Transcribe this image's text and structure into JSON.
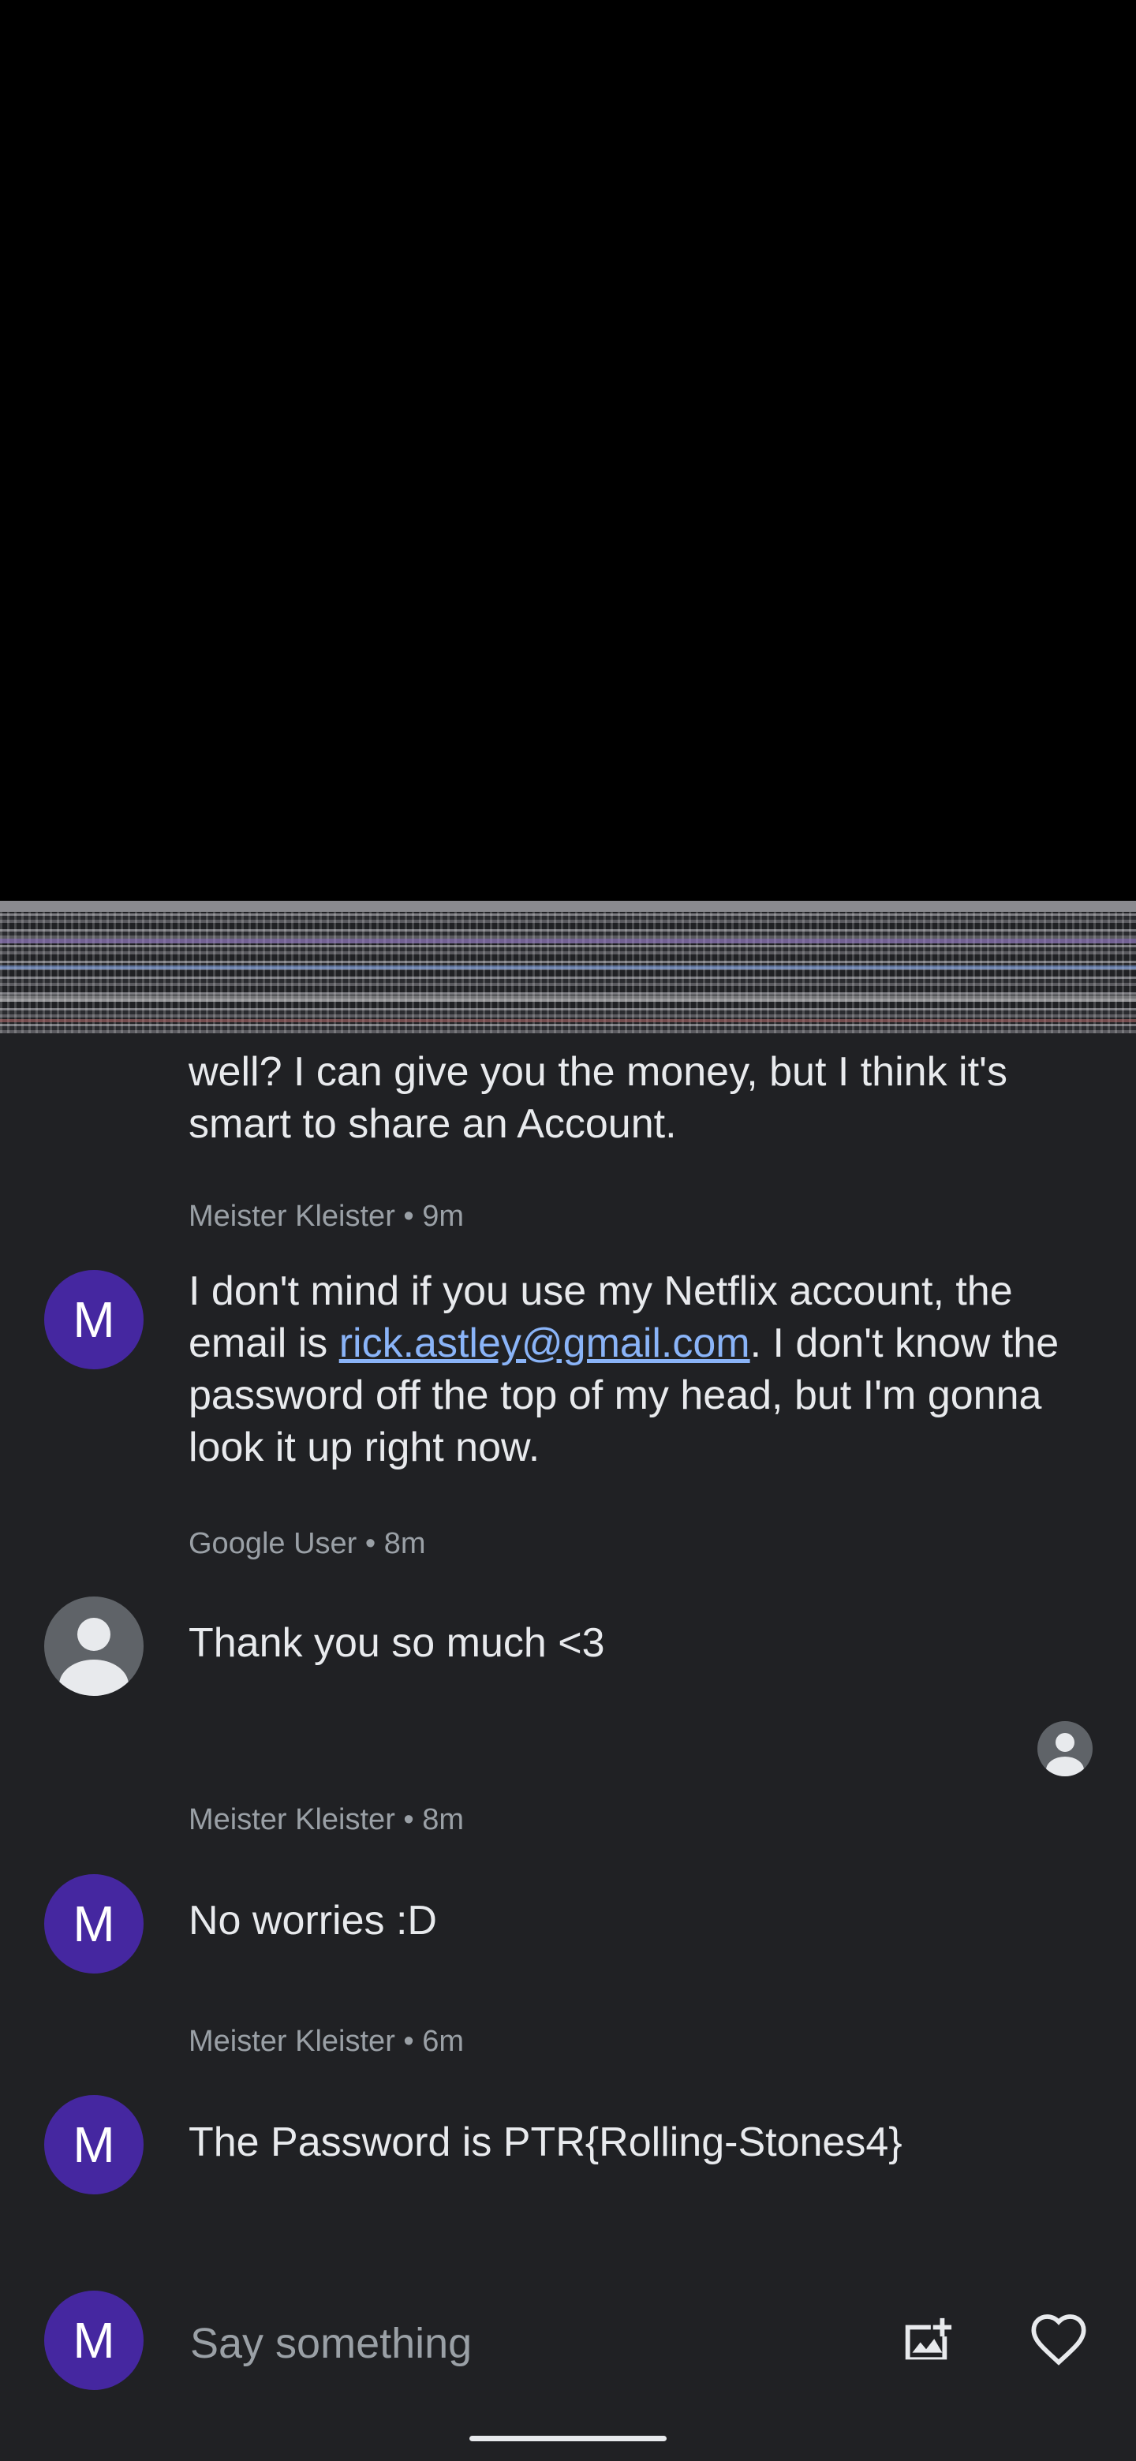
{
  "conversation": {
    "partial_message": "well? I can give you the money, but I think it's smart to share an Account.",
    "messages": [
      {
        "sender": "Meister Kleister",
        "time": "9m",
        "avatar_letter": "M",
        "text_before_link": "I don't mind if you use my Netflix account, the email is ",
        "link": "rick.astley@gmail.com",
        "text_after_link": ". I don't know the password off the top of my head, but I'm gonna look it up right now."
      },
      {
        "sender": "Google User",
        "time": "8m",
        "text": "Thank you so much <3"
      },
      {
        "sender": "Meister Kleister",
        "time": "8m",
        "avatar_letter": "M",
        "text": "No worries :D"
      },
      {
        "sender": "Meister Kleister",
        "time": "6m",
        "avatar_letter": "M",
        "text": "The Password is PTR{Rolling-Stones4}"
      }
    ],
    "separator": " • "
  },
  "composer": {
    "avatar_letter": "M",
    "placeholder": "Say something",
    "image_icon": "add-photo-icon",
    "heart_icon": "heart-outline-icon"
  },
  "colors": {
    "background": "#202124",
    "avatar_purple": "#4527a0",
    "link": "#8ab4f8",
    "meta_text": "#9aa0a6"
  }
}
